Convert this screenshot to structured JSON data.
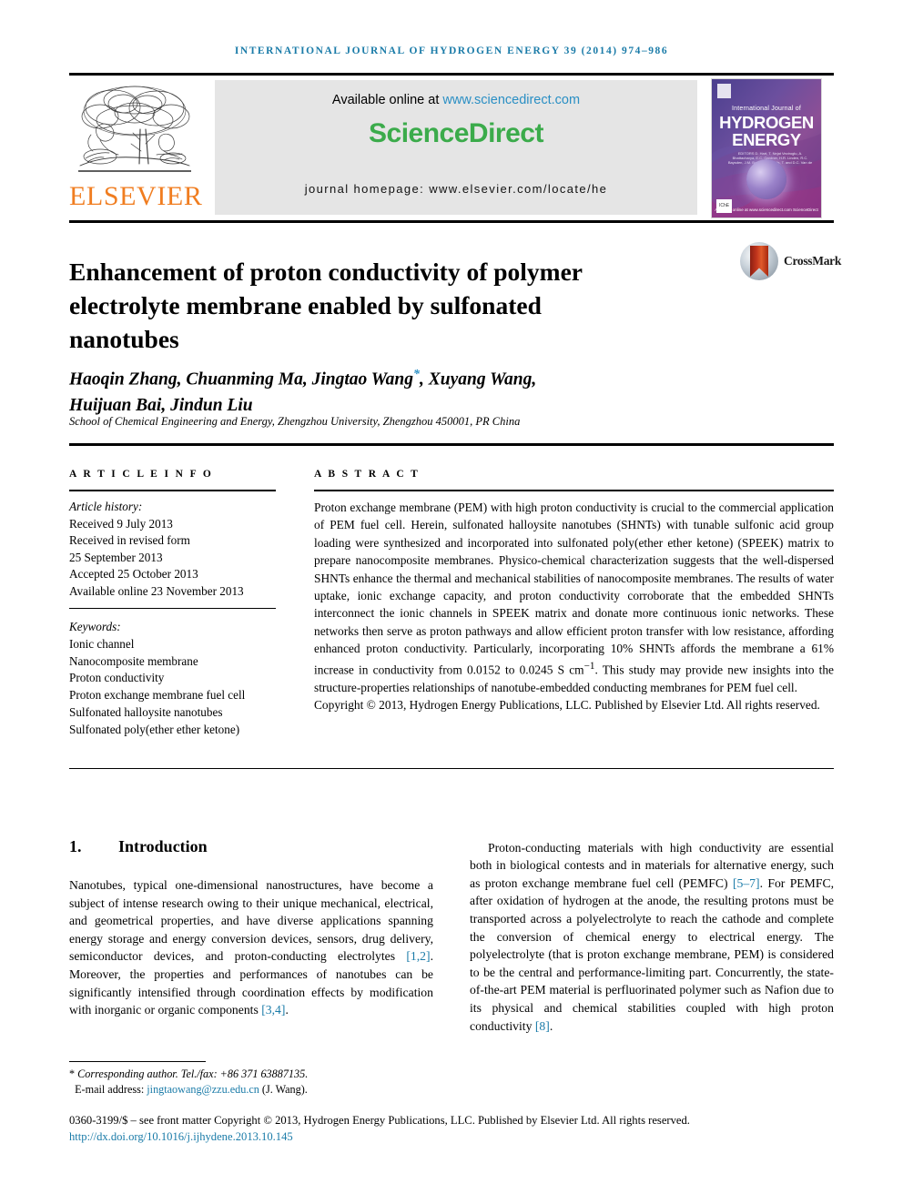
{
  "running_head": "International Journal of Hydrogen Energy 39 (2014) 974–986",
  "masthead": {
    "available_prefix": "Available online at ",
    "available_url": "www.sciencedirect.com",
    "wordmark": "ScienceDirect",
    "homepage": "journal homepage: www.elsevier.com/locate/he",
    "publisher_name": "ELSEVIER",
    "cover": {
      "line_small": "International Journal of",
      "line1": "HYDROGEN",
      "line2": "ENERGY",
      "editors": "EDITORS  D. Hart, T. Nejat Veziroglu, A. Bhattacharya, E.C. Gardner, H.R. Linden, R.C. Baysden, J.M. Barker, G.E. Ellis, T. and D.C. Van de Valle",
      "footer": "Available online at www.sciencedirect.com ScienceDirect",
      "iche_mark": "IChE"
    }
  },
  "article": {
    "title": "Enhancement of proton conductivity of polymer electrolyte membrane enabled by sulfonated nanotubes",
    "crossmark_label": "CrossMark",
    "authors_line1": "Haoqin Zhang, Chuanming Ma, Jingtao Wang",
    "authors_star": "*",
    "authors_line1_tail": ", Xuyang Wang,",
    "authors_line2": "Huijuan Bai, Jindun Liu",
    "affiliation": "School of Chemical Engineering and Energy, Zhengzhou University, Zhengzhou 450001, PR China"
  },
  "sections": {
    "info_heading": "A R T I C L E   I N F O",
    "abstract_heading": "A B S T R A C T"
  },
  "article_history": {
    "label": "Article history:",
    "lines": [
      "Received 9 July 2013",
      "Received in revised form",
      "25 September 2013",
      "Accepted 25 October 2013",
      "Available online 23 November 2013"
    ]
  },
  "keywords": {
    "label": "Keywords:",
    "items": [
      "Ionic channel",
      "Nanocomposite membrane",
      "Proton conductivity",
      "Proton exchange membrane fuel cell",
      "Sulfonated halloysite nanotubes",
      "Sulfonated poly(ether ether ketone)"
    ]
  },
  "abstract": {
    "body": "Proton exchange membrane (PEM) with high proton conductivity is crucial to the commercial application of PEM fuel cell. Herein, sulfonated halloysite nanotubes (SHNTs) with tunable sulfonic acid group loading were synthesized and incorporated into sulfonated poly(ether ether ketone) (SPEEK) matrix to prepare nanocomposite membranes. Physico-chemical characterization suggests that the well-dispersed SHNTs enhance the thermal and mechanical stabilities of nanocomposite membranes. The results of water uptake, ionic exchange capacity, and proton conductivity corroborate that the embedded SHNTs interconnect the ionic channels in SPEEK matrix and donate more continuous ionic networks. These networks then serve as proton pathways and allow efficient proton transfer with low resistance, affording enhanced proton conductivity. Particularly, incorporating 10% SHNTs affords the membrane a 61% increase in conductivity from 0.0152 to 0.0245 S cm",
    "unit_sup": "−1",
    "body_tail": ". This study may provide new insights into the structure-properties relationships of nanotube-embedded conducting membranes for PEM fuel cell.",
    "copyright": "Copyright © 2013, Hydrogen Energy Publications, LLC. Published by Elsevier Ltd. All rights reserved."
  },
  "introduction": {
    "number": "1.",
    "heading": "Introduction",
    "para1_a": "Nanotubes, typical one-dimensional nanostructures, have become a subject of intense research owing to their unique mechanical, electrical, and geometrical properties, and have diverse applications spanning energy storage and energy conversion devices, sensors, drug delivery, semiconductor devices, and proton-conducting electrolytes ",
    "ref_12": "[1,2]",
    "para1_b": ". Moreover, the properties and performances of nanotubes can be significantly intensified through coordination effects by modification with inorganic or organic components ",
    "ref_34": "[3,4]",
    "para1_c": ".",
    "para2_a": "Proton-conducting materials with high conductivity are essential both in biological contests and in materials for alternative energy, such as proton exchange membrane fuel cell (PEMFC) ",
    "ref_57": "[5–7]",
    "para2_b": ". For PEMFC, after oxidation of hydrogen at the anode, the resulting protons must be transported across a polyelectrolyte to reach the cathode and complete the conversion of chemical energy to electrical energy. The polyelectrolyte (that is proton exchange membrane, PEM) is considered to be the central and performance-limiting part. Concurrently, the state-of-the-art PEM material is perfluorinated polymer such as Nafion due to its physical and chemical stabilities coupled with high proton conductivity ",
    "ref_8": "[8]",
    "para2_c": "."
  },
  "footnote": {
    "star": "*",
    "corresponding": "Corresponding author. Tel./fax: +86 371 63887135.",
    "email_label": "E-mail address: ",
    "email": "jingtaowang@zzu.edu.cn",
    "email_tail": " (J. Wang)."
  },
  "footer": {
    "copyright_line": "0360-3199/$ – see front matter Copyright © 2013, Hydrogen Energy Publications, LLC. Published by Elsevier Ltd. All rights reserved.",
    "doi": "http://dx.doi.org/10.1016/j.ijhydene.2013.10.145"
  },
  "colors": {
    "link": "#1a7ba8",
    "sciencedirect_green": "#3bab4b",
    "elsevier_orange": "#f07d20",
    "sd_panel_bg": "#e5e5e5"
  }
}
